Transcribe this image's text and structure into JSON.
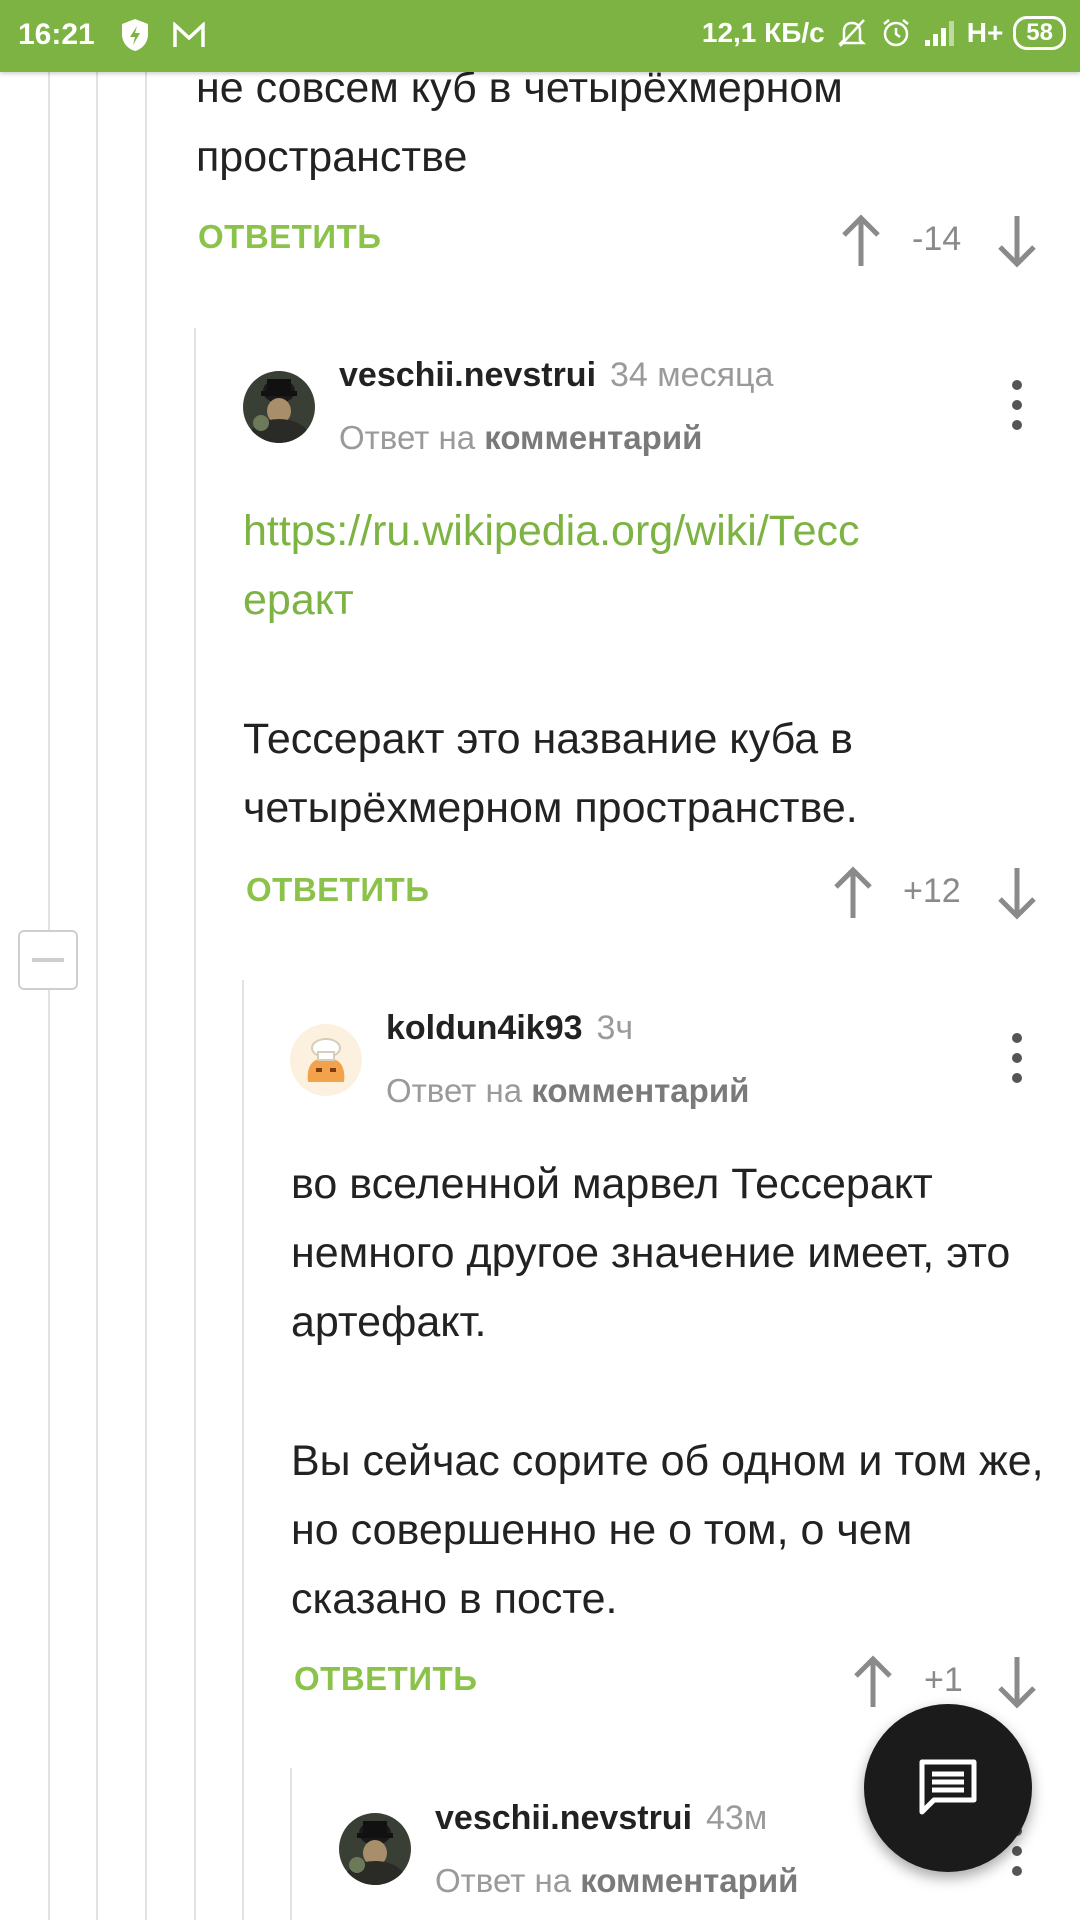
{
  "status_bar": {
    "time": "16:21",
    "speed": "12,1 КБ/с",
    "network": "H+",
    "battery": "58"
  },
  "comment_top": {
    "text": "не совсем куб в четырёхмерном пространстве",
    "reply_label": "ОТВЕТИТЬ",
    "score": "-14"
  },
  "comment_1": {
    "author": "veschii.nevstrui",
    "time": "34 месяца",
    "reply_to_prefix": "Ответ на",
    "reply_to_target": "комментарий",
    "link": "https://ru.wikipedia.org/wiki/Тессеракт",
    "text": "Тессеракт это название куба в четырёхмерном пространстве.",
    "reply_label": "ОТВЕТИТЬ",
    "score": "+12"
  },
  "comment_2": {
    "author": "koldun4ik93",
    "time": "3ч",
    "reply_to_prefix": "Ответ на",
    "reply_to_target": "комментарий",
    "paragraph_1": "во вселенной марвел Тессеракт немного другое значение имеет, это артефакт.",
    "paragraph_2": "Вы сейчас сорите об одном и том же, но совершенно не о том, о чем сказано в посте.",
    "reply_label": "ОТВЕТИТЬ",
    "score": "+1"
  },
  "comment_3": {
    "author": "veschii.nevstrui",
    "time": "43м",
    "reply_to_prefix": "Ответ на",
    "reply_to_target": "комментарий"
  },
  "colors": {
    "accent": "#7cb342",
    "fab": "#1b1b1b"
  }
}
